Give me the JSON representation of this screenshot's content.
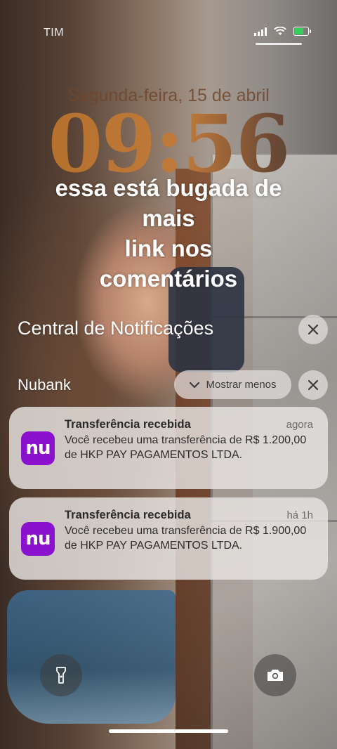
{
  "status_bar": {
    "carrier": "TIM"
  },
  "lock_screen": {
    "date": "Segunda-feira, 15 de abril",
    "time": "09:56"
  },
  "overlay_caption": {
    "lines": [
      "essa está bugada de",
      "mais",
      "link nos",
      "comentários"
    ]
  },
  "notification_center": {
    "title": "Central de Notificações",
    "group": {
      "app_name": "Nubank",
      "show_less_label": "Mostrar menos"
    },
    "notifications": [
      {
        "app_icon_text": "nu",
        "title": "Transferência recebida",
        "time": "agora",
        "body": "Você recebeu uma transferência de R$ 1.200,00 de HKP PAY PAGAMENTOS LTDA."
      },
      {
        "app_icon_text": "nu",
        "title": "Transferência recebida",
        "time": "há 1h",
        "body": "Você recebeu uma transferência de R$ 1.900,00 de HKP PAY PAGAMENTOS LTDA."
      }
    ]
  },
  "icons": {
    "close": "close-icon",
    "chevron": "chevron-down-icon",
    "flashlight": "flashlight-icon",
    "camera": "camera-icon",
    "battery_color": "#35d05a",
    "nubank_color": "#8a12cf"
  }
}
